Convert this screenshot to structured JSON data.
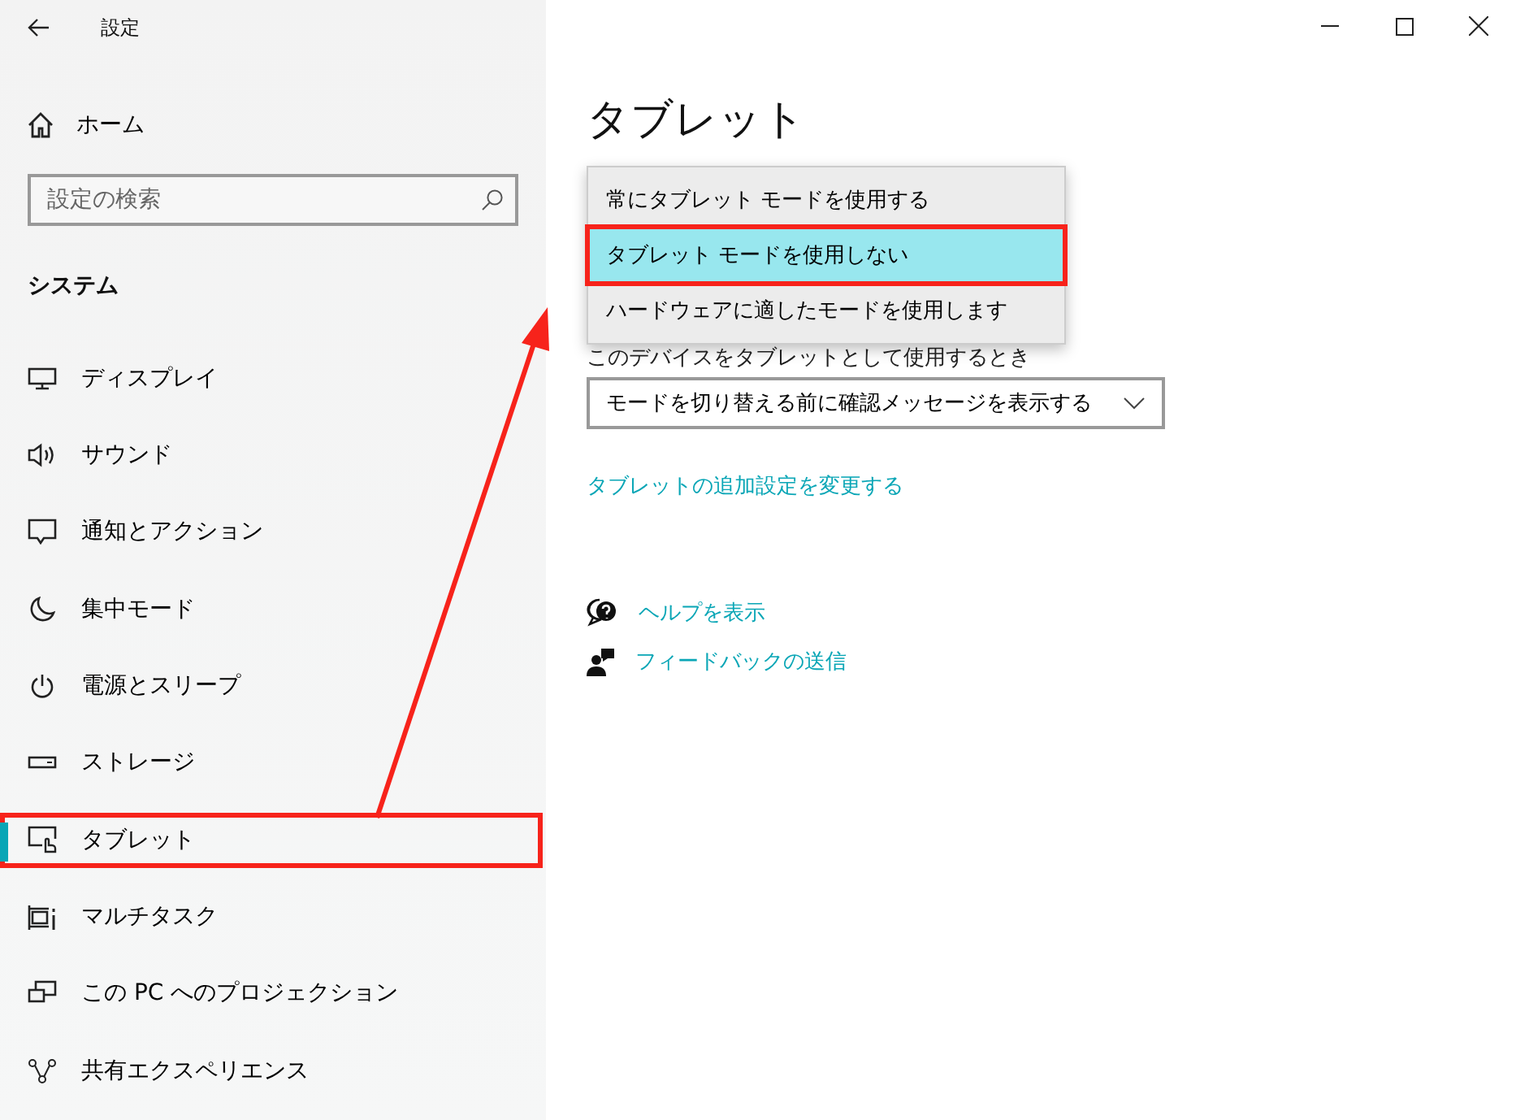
{
  "window": {
    "title": "設定"
  },
  "sidebar": {
    "home": "ホーム",
    "search": {
      "placeholder": "設定の検索"
    },
    "section": "システム",
    "items": [
      {
        "label": "ディスプレイ",
        "selected": false,
        "marked": false
      },
      {
        "label": "サウンド",
        "selected": false,
        "marked": false
      },
      {
        "label": "通知とアクション",
        "selected": false,
        "marked": false
      },
      {
        "label": "集中モード",
        "selected": false,
        "marked": false
      },
      {
        "label": "電源とスリープ",
        "selected": false,
        "marked": false
      },
      {
        "label": "ストレージ",
        "selected": false,
        "marked": false
      },
      {
        "label": "タブレット",
        "selected": true,
        "marked": true
      },
      {
        "label": "マルチタスク",
        "selected": false,
        "marked": false
      },
      {
        "label": "この PC へのプロジェクション",
        "selected": false,
        "marked": false
      },
      {
        "label": "共有エクスペリエンス",
        "selected": false,
        "marked": false
      }
    ]
  },
  "content": {
    "title": "タブレット",
    "popup": {
      "options": [
        {
          "label": "常にタブレット モードを使用する",
          "selected": false,
          "marked": false
        },
        {
          "label": "タブレット モードを使用しない",
          "selected": true,
          "marked": true
        },
        {
          "label": "ハードウェアに適したモードを使用します",
          "selected": false,
          "marked": false
        }
      ]
    },
    "field_label": "このデバイスをタブレットとして使用するとき",
    "dropdown": {
      "value": "モードを切り替える前に確認メッセージを表示する"
    },
    "link": "タブレットの追加設定を変更する",
    "help_links": [
      {
        "label": "ヘルプを表示"
      },
      {
        "label": "フィードバックの送信"
      }
    ]
  }
}
